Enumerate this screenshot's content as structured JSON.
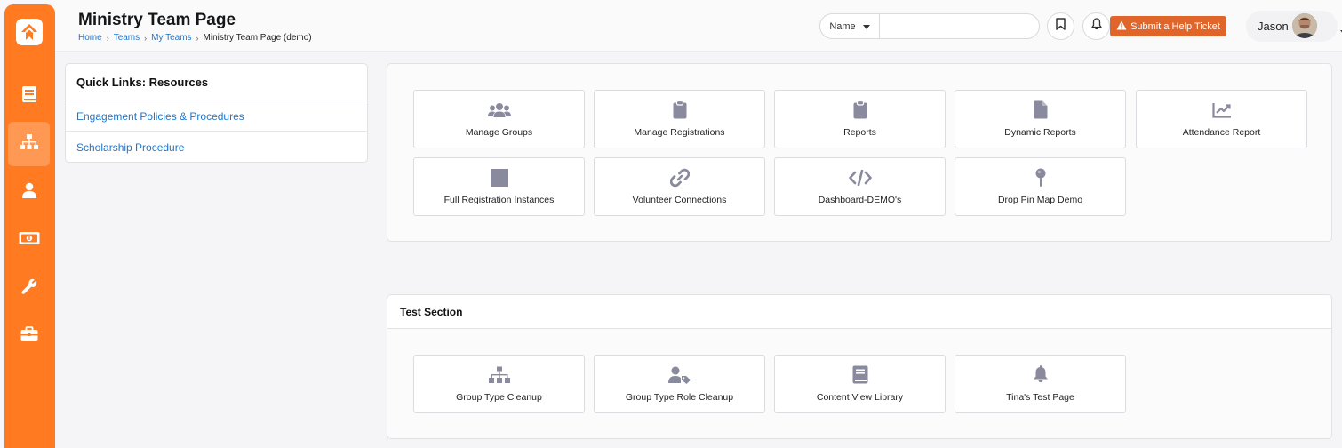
{
  "header": {
    "title": "Ministry Team Page",
    "breadcrumb": [
      "Home",
      "Teams",
      "My Teams",
      "Ministry Team Page (demo)"
    ],
    "search": {
      "type_label": "Name",
      "placeholder": ""
    },
    "help_ticket_label": "Submit a Help Ticket",
    "user_name": "Jason"
  },
  "sidebar": {
    "items": [
      {
        "icon": "book-icon",
        "active": false
      },
      {
        "icon": "org-chart-icon",
        "active": true
      },
      {
        "icon": "user-icon",
        "active": false
      },
      {
        "icon": "money-icon",
        "active": false
      },
      {
        "icon": "wrench-icon",
        "active": false
      },
      {
        "icon": "briefcase-icon",
        "active": false
      }
    ]
  },
  "quick_links": {
    "title": "Quick Links: Resources",
    "links": [
      "Engagement Policies & Procedures",
      "Scholarship Procedure"
    ]
  },
  "main_tiles": [
    {
      "label": "Manage Groups",
      "icon": "users-icon"
    },
    {
      "label": "Manage Registrations",
      "icon": "clipboard-icon"
    },
    {
      "label": "Reports",
      "icon": "clipboard-icon"
    },
    {
      "label": "Dynamic Reports",
      "icon": "file-icon"
    },
    {
      "label": "Attendance Report",
      "icon": "chart-line-icon"
    },
    {
      "label": "Full Registration Instances",
      "icon": "square-icon"
    },
    {
      "label": "Volunteer Connections",
      "icon": "link-icon"
    },
    {
      "label": "Dashboard-DEMO's",
      "icon": "code-icon"
    },
    {
      "label": "Drop Pin Map Demo",
      "icon": "map-pin-icon"
    }
  ],
  "test_section": {
    "title": "Test Section",
    "tiles": [
      {
        "label": "Group Type Cleanup",
        "icon": "sitemap-icon"
      },
      {
        "label": "Group Type Role Cleanup",
        "icon": "user-tag-icon"
      },
      {
        "label": "Content View Library",
        "icon": "book-icon"
      },
      {
        "label": "Tina's Test Page",
        "icon": "bell-icon"
      }
    ]
  },
  "colors": {
    "brand": "#ff7a21",
    "help_button": "#e0652b",
    "link": "#2276c9",
    "icon": "#8a8a9e"
  }
}
